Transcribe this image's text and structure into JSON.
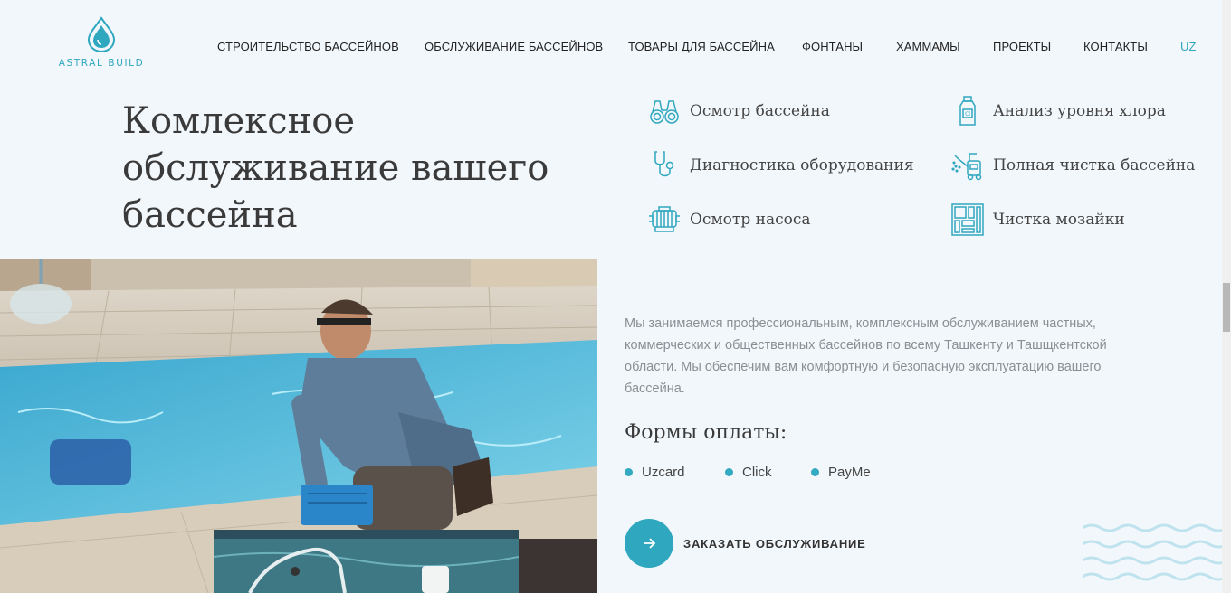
{
  "brand": {
    "logo_text": "ASTRAL BUILD"
  },
  "nav": {
    "items": [
      "СТРОИТЕЛЬСТВО БАССЕЙНОВ",
      "ОБСЛУЖИВАНИЕ БАССЕЙНОВ",
      "ТОВАРЫ ДЛЯ БАССЕЙНА",
      "ФОНТАНЫ",
      "ХАММАМЫ",
      "ПРОЕКТЫ",
      "КОНТАКТЫ"
    ],
    "lang": "UZ"
  },
  "hero": {
    "title_lines": [
      "Комлексное",
      "обслуживание вашего",
      "бассейна"
    ]
  },
  "services": [
    {
      "label": "Осмотр бассейна",
      "icon": "binoculars-icon"
    },
    {
      "label": "Анализ уровня хлора",
      "icon": "chlorine-bottle-icon"
    },
    {
      "label": "Диагностика оборудования",
      "icon": "stethoscope-icon"
    },
    {
      "label": "Полная чистка бассейна",
      "icon": "pressure-washer-icon"
    },
    {
      "label": "Осмотр насоса",
      "icon": "pump-icon"
    },
    {
      "label": "Чистка мозайки",
      "icon": "mosaic-tiles-icon"
    }
  ],
  "description": "Мы занимаемся профессиональным, комплексным обслуживанием частных, коммерческих и общественных бассейнов по всему Ташкенту и Ташщкентской области. Мы обеспечим вам комфортную и безопасную эксплуатацию вашего бассейна.",
  "payment": {
    "title": "Формы оплаты:",
    "methods": [
      "Uzcard",
      "Click",
      "PayMe"
    ]
  },
  "cta": {
    "label": "ЗАКАЗАТЬ ОБСЛУЖИВАНИЕ"
  },
  "colors": {
    "accent": "#2fa7bf",
    "background": "#f2f7fb",
    "text": "#3a3a3a"
  }
}
